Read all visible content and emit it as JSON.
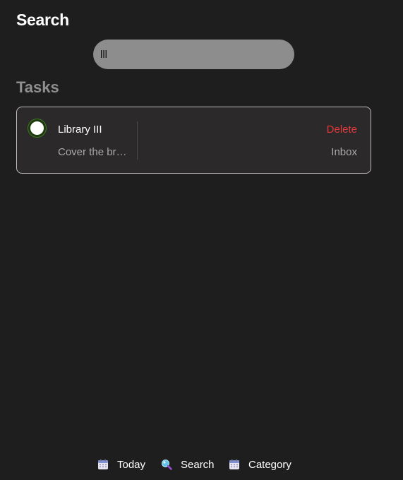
{
  "header": {
    "title": "Search"
  },
  "search": {
    "value": "lll",
    "placeholder": ""
  },
  "tasks_section": {
    "title": "Tasks",
    "items": [
      {
        "title": "Library III",
        "description": "Cover the bri…",
        "delete_label": "Delete",
        "category": "Inbox",
        "completed": false
      }
    ]
  },
  "bottom_nav": {
    "items": [
      {
        "label": "Today",
        "icon": "calendar-icon"
      },
      {
        "label": "Search",
        "icon": "magnifier-icon"
      },
      {
        "label": "Category",
        "icon": "calendar-icon"
      }
    ]
  },
  "colors": {
    "background": "#1e1e1f",
    "card_background": "#2b292a",
    "delete": "#e0393b",
    "muted_text": "#a9a9a9"
  }
}
